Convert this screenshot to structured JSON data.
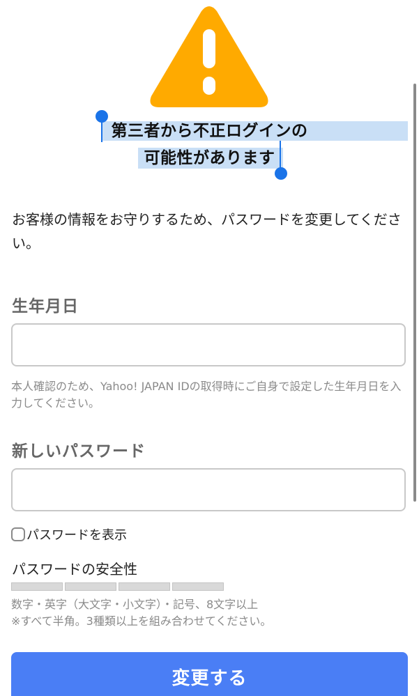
{
  "colors": {
    "warning": "#ffaa00",
    "primary_button": "#4a7ef5",
    "selection_highlight": "#c9dff6",
    "selection_handle": "#1a73e8"
  },
  "alert": {
    "icon": "warning-triangle-icon",
    "title_line1": "第三者から不正ログインの",
    "title_line2": "可能性があります"
  },
  "description": "お客様の情報をお守りするため、パスワードを変更してください。",
  "birthdate": {
    "label": "生年月日",
    "value": "",
    "help": "本人確認のため、Yahoo! JAPAN IDの取得時にご自身で設定した生年月日を入力してください。"
  },
  "new_password": {
    "label": "新しいパスワード",
    "value": "",
    "show_password_label": "パスワードを表示",
    "show_password_checked": false
  },
  "strength": {
    "title": "パスワードの安全性",
    "level": 0,
    "segments": 4,
    "rules_line1": "数字・英字（大文字・小文字）・記号、8文字以上",
    "rules_line2": "※すべて半角。3種類以上を組み合わせてください。"
  },
  "submit_label": "変更する"
}
